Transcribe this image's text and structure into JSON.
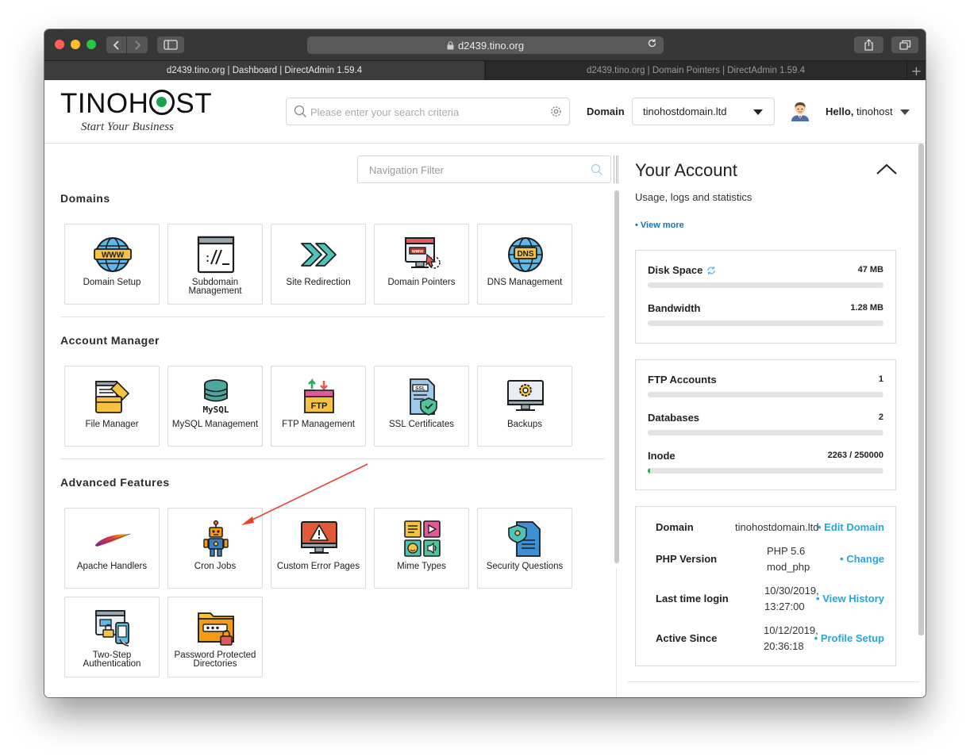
{
  "browser": {
    "address": "d2439.tino.org",
    "tabs": [
      {
        "title": "d2439.tino.org | Dashboard | DirectAdmin 1.59.4"
      },
      {
        "title": "d2439.tino.org | Domain Pointers | DirectAdmin 1.59.4"
      }
    ]
  },
  "header": {
    "logo": {
      "main": "TINOH",
      "main_tail": "ST",
      "tagline": "Start Your Business"
    },
    "search_placeholder": "Please enter your search criteria",
    "domain_label": "Domain",
    "domain_value": "tinohostdomain.ltd",
    "greeting": "Hello,",
    "username": "tinohost"
  },
  "nav_filter_placeholder": "Navigation Filter",
  "sections": [
    {
      "title": "Domains",
      "items": [
        {
          "label": "Domain Setup",
          "icon": "www-globe-icon"
        },
        {
          "label": "Subdomain Management",
          "icon": "terminal-window-icon"
        },
        {
          "label": "Site Redirection",
          "icon": "redirect-arrows-icon"
        },
        {
          "label": "Domain Pointers",
          "icon": "domain-pointer-screen-icon"
        },
        {
          "label": "DNS Management",
          "icon": "dns-globe-icon"
        }
      ]
    },
    {
      "title": "Account Manager",
      "items": [
        {
          "label": "File Manager",
          "icon": "folder-files-icon"
        },
        {
          "label": "MySQL Management",
          "icon": "mysql-database-icon",
          "caption": "MySQL"
        },
        {
          "label": "FTP Management",
          "icon": "ftp-folder-icon",
          "caption": "FTP"
        },
        {
          "label": "SSL Certificates",
          "icon": "ssl-certificate-icon",
          "caption": "SSL"
        },
        {
          "label": "Backups",
          "icon": "backup-monitor-gear-icon"
        }
      ]
    },
    {
      "title": "Advanced Features",
      "items": [
        {
          "label": "Apache Handlers",
          "icon": "apache-feather-icon"
        },
        {
          "label": "Cron Jobs",
          "icon": "robot-icon"
        },
        {
          "label": "Custom Error Pages",
          "icon": "error-monitor-icon"
        },
        {
          "label": "Mime Types",
          "icon": "mime-media-icon"
        },
        {
          "label": "Security Questions",
          "icon": "security-document-icon"
        },
        {
          "label": "Two-Step Authentication",
          "icon": "two-step-lock-icon"
        },
        {
          "label": "Password Protected Directories",
          "icon": "locked-folder-icon"
        }
      ]
    }
  ],
  "account": {
    "title": "Your Account",
    "subtitle": "Usage, logs and statistics",
    "view_more": "• View more",
    "usage": [
      {
        "label": "Disk Space",
        "value": "47 MB",
        "fraction": 0
      },
      {
        "label": "Bandwidth",
        "value": "1.28 MB",
        "fraction": 0
      }
    ],
    "counts": [
      {
        "label": "FTP Accounts",
        "value": "1",
        "fraction": 0
      },
      {
        "label": "Databases",
        "value": "2",
        "fraction": 0
      },
      {
        "label": "Inode",
        "value": "2263 / 250000",
        "fraction": 0.009
      }
    ],
    "info": [
      {
        "label": "Domain",
        "value": "tinohostdomain.ltd",
        "action": "• Edit Domain"
      },
      {
        "label": "PHP Version",
        "value": "PHP 5.6",
        "value2": "mod_php",
        "action": "• Change"
      },
      {
        "label": "Last time login",
        "value": "10/30/2019,",
        "value2": "13:27:00",
        "action": "• View History"
      },
      {
        "label": "Active Since",
        "value": "10/12/2019,",
        "value2": "20:36:18",
        "action": "• Profile Setup"
      }
    ]
  },
  "colors": {
    "accent_link": "#2aa5d8",
    "arrow": "#e8442a",
    "bar_fill": "#27ae60"
  }
}
